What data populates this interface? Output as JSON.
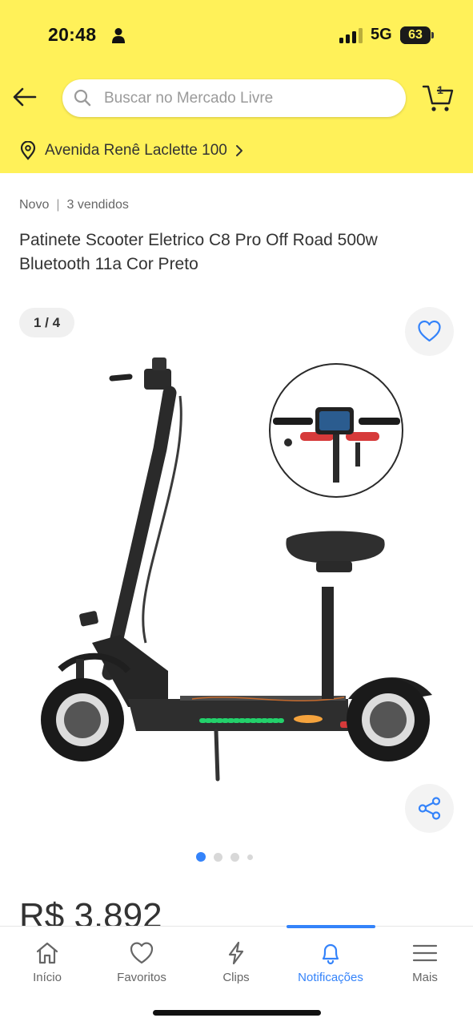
{
  "status_bar": {
    "time": "20:48",
    "network": "5G",
    "battery": "63",
    "battery_level": 0.63
  },
  "header": {
    "search_placeholder": "Buscar no Mercado Livre",
    "cart_count": "1",
    "address": "Avenida Renê Laclette 100",
    "brand_color": "#fff159"
  },
  "product": {
    "condition": "Novo",
    "separator": "|",
    "sold": "3 vendidos",
    "title": "Patinete Scooter Eletrico C8 Pro Off Road 500w Bluetooth 11a Cor Preto",
    "price": "R$ 3.892"
  },
  "gallery": {
    "counter": "1 / 4",
    "current_image": 1,
    "total_images": 4
  },
  "tabs": [
    {
      "label": "Início",
      "icon": "home-icon",
      "active": false
    },
    {
      "label": "Favoritos",
      "icon": "heart-icon",
      "active": false
    },
    {
      "label": "Clips",
      "icon": "lightning-icon",
      "active": false
    },
    {
      "label": "Notificações",
      "icon": "bell-icon",
      "active": true
    },
    {
      "label": "Mais",
      "icon": "menu-icon",
      "active": false
    }
  ],
  "colors": {
    "accent_blue": "#3483fa",
    "text": "#333333",
    "muted": "#666666"
  }
}
